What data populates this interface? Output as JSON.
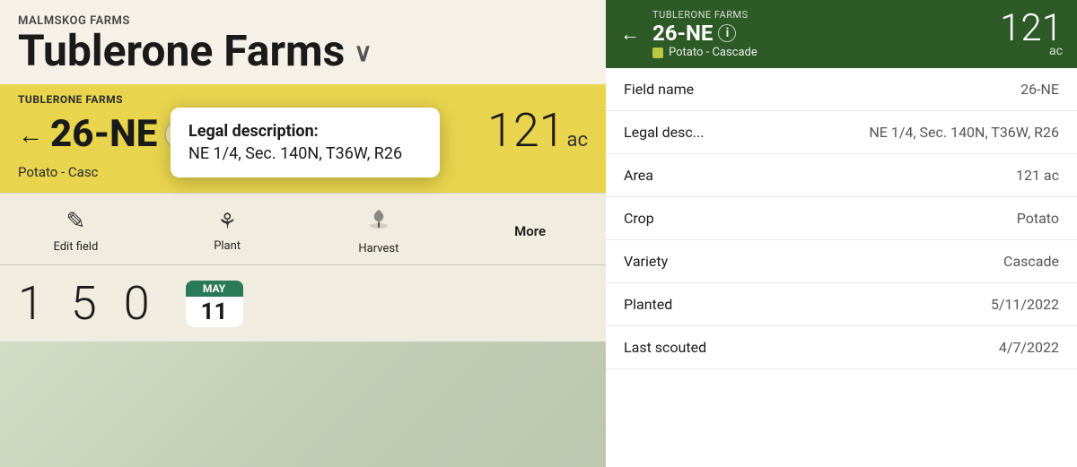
{
  "left": {
    "farm_name_small": "MALMSKOG FARMS",
    "farm_name_large": "Tublerone Farms",
    "chevron": "∨",
    "field_strip": {
      "label": "TUBLERONE FARMS",
      "back_arrow": "←",
      "field_number": "26-NE",
      "area": "121",
      "area_unit": "ac",
      "crop": "Potato - Casc"
    },
    "legal_tooltip": {
      "title": "Legal description:",
      "text": "NE 1/4, Sec. 140N, T36W, R26"
    },
    "action_bar": {
      "edit_label": "Edit field",
      "plant_label": "Plant",
      "harvest_label": "Harvest",
      "more_label": "More"
    },
    "bottom_numbers": [
      "1",
      "5",
      "0"
    ],
    "calendar": {
      "month": "MAY",
      "day": "11"
    }
  },
  "right": {
    "header": {
      "farm_name": "TUBLERONE FARMS",
      "back_arrow": "←",
      "field_number": "26-NE",
      "info_icon": "i",
      "crop": "Potato - Cascade",
      "area": "121",
      "area_unit": "ac"
    },
    "details": [
      {
        "key": "Field name",
        "value": "26-NE"
      },
      {
        "key": "Legal desc...",
        "value": "NE 1/4, Sec. 140N, T36W, R26"
      },
      {
        "key": "Area",
        "value": "121 ac"
      },
      {
        "key": "Crop",
        "value": "Potato"
      },
      {
        "key": "Variety",
        "value": "Cascade"
      },
      {
        "key": "Planted",
        "value": "5/11/2022"
      },
      {
        "key": "Last scouted",
        "value": "4/7/2022"
      }
    ]
  },
  "icons": {
    "pencil": "✎",
    "plant": "⚘",
    "harvest": "🌾",
    "back": "←"
  }
}
